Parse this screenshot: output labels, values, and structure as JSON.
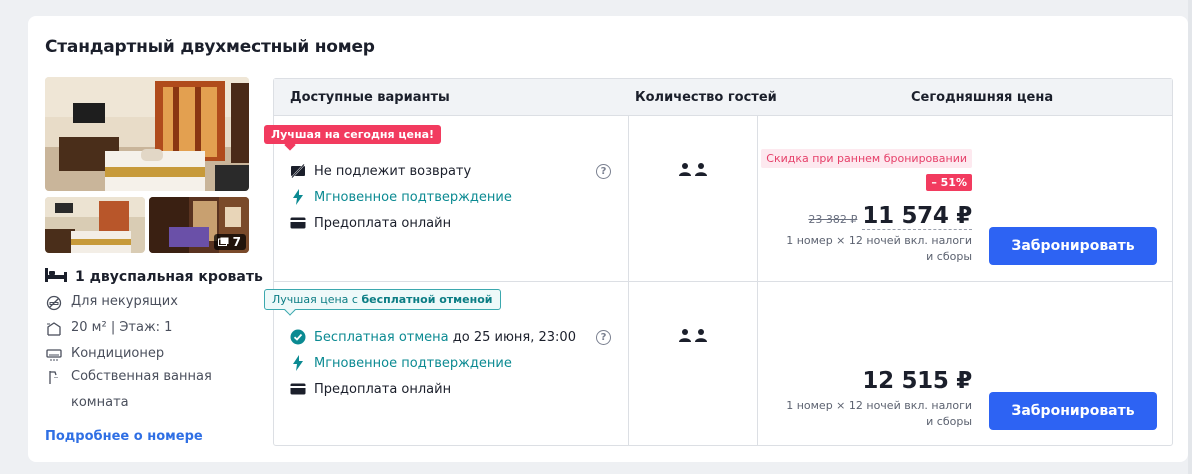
{
  "room": {
    "title": "Стандартный двухместный номер",
    "photo_count": "7",
    "bed": "1 двуспальная кровать",
    "amenities": [
      {
        "icon": "no-smoking-icon",
        "label": "Для некурящих"
      },
      {
        "icon": "area-icon",
        "label": "20 м² | Этаж: 1"
      },
      {
        "icon": "air-conditioner-icon",
        "label": "Кондиционер"
      },
      {
        "icon": "shower-icon",
        "label": "Собственная ванная комната"
      }
    ],
    "more_link": "Подробнее о номере"
  },
  "table": {
    "headers": [
      "Доступные варианты",
      "Количество гостей",
      "Сегодняшняя цена"
    ]
  },
  "offers": [
    {
      "badge": "Лучшая на сегодня цена!",
      "features": [
        {
          "icon": "no-refund-icon",
          "text": "Не подлежит возврату"
        },
        {
          "icon": "lightning-icon",
          "text": "Мгновенное подтверждение"
        },
        {
          "icon": "card-icon",
          "text": "Предоплата онлайн"
        }
      ],
      "guests": 2,
      "early_booking": "Скидка при раннем бронировании",
      "discount": "– 51%",
      "old_price": "23 382 ₽",
      "price": "11 574 ₽",
      "price_note": "1 номер × 12 ночей вкл. налоги и сборы",
      "book_label": "Забронировать"
    },
    {
      "badge_prefix": "Лучшая цена с ",
      "badge_bold": "бесплатной отменой",
      "cancel_link": "Бесплатная отмена",
      "cancel_rest": " до 25 июня, 23:00",
      "features": [
        {
          "icon": "lightning-icon",
          "text": "Мгновенное подтверждение"
        },
        {
          "icon": "card-icon",
          "text": "Предоплата онлайн"
        }
      ],
      "guests": 2,
      "price": "12 515 ₽",
      "price_note": "1 номер × 12 ночей вкл. налоги и сборы",
      "book_label": "Забронировать"
    }
  ],
  "colors": {
    "accent": "#2d63f3",
    "badge_red": "#f23b5f",
    "teal": "#0b8a92",
    "link": "#2f6fe4"
  }
}
